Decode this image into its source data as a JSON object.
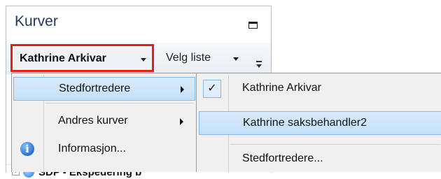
{
  "panel": {
    "title": "Kurver"
  },
  "toolbar": {
    "user_button_label": "Kathrine Arkivar",
    "list_button_label": "Velg liste"
  },
  "tree": {
    "partial_row_label": "SDP - Ekspedering b"
  },
  "context_menu": {
    "items": [
      {
        "label": "Stedfortredere",
        "has_submenu": true,
        "highlighted": true
      },
      {
        "label": "Andres kurver",
        "has_submenu": true,
        "highlighted": false
      },
      {
        "label": "Informasjon...",
        "icon": "info-icon",
        "has_submenu": false,
        "highlighted": false
      }
    ]
  },
  "submenu": {
    "items": [
      {
        "label": "Kathrine Arkivar",
        "checked": true,
        "highlighted": false
      },
      {
        "label": "Kathrine saksbehandler2",
        "checked": false,
        "highlighted": true
      },
      {
        "label": "Stedfortredere...",
        "checked": false,
        "highlighted": false
      }
    ]
  },
  "colors": {
    "highlight_border": "#e51d1d",
    "menu_hover": "#c4e0f9",
    "menu_background": "#f0f0f0",
    "panel_title": "#1e3a5f"
  }
}
